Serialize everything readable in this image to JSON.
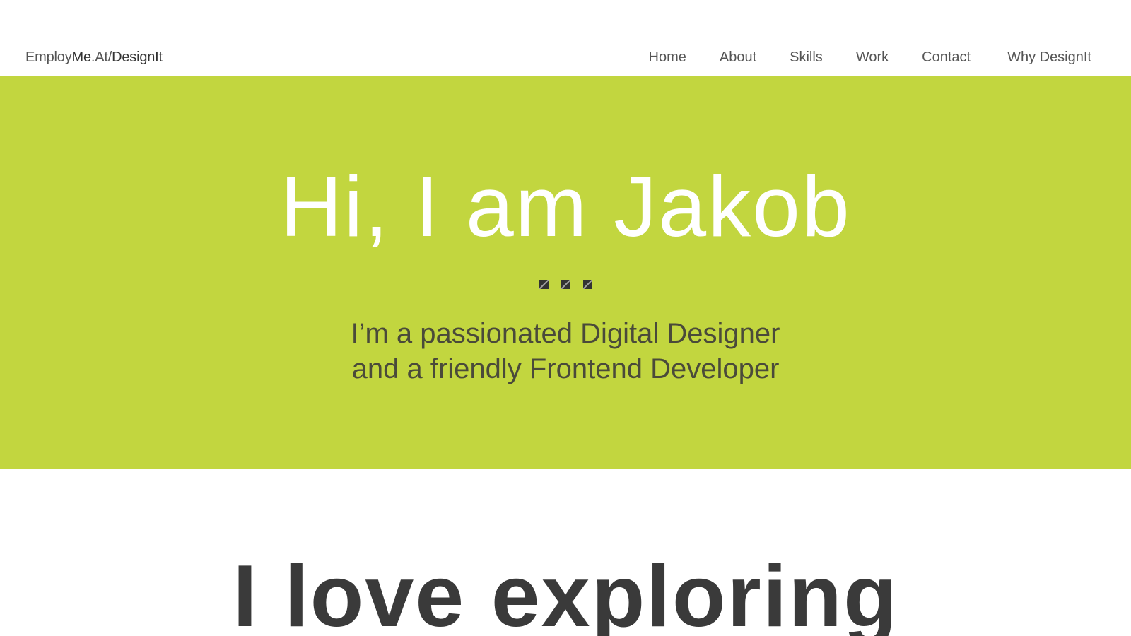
{
  "header": {
    "logo": {
      "part1": "Employ",
      "part2": "Me",
      "part3": ".At/",
      "part4": "DesignIt"
    },
    "nav": [
      {
        "label": "Home"
      },
      {
        "label": "About"
      },
      {
        "label": "Skills"
      },
      {
        "label": "Work"
      },
      {
        "label": "Contact"
      },
      {
        "label": "Why DesignIt"
      }
    ]
  },
  "hero": {
    "title": "Hi, I am Jakob",
    "subtitle_line1": "I’m a passionated Digital Designer",
    "subtitle_line2": "and a friendly Frontend Developer",
    "background_color": "#c2d63f"
  },
  "section": {
    "heading": "I love exploring"
  }
}
